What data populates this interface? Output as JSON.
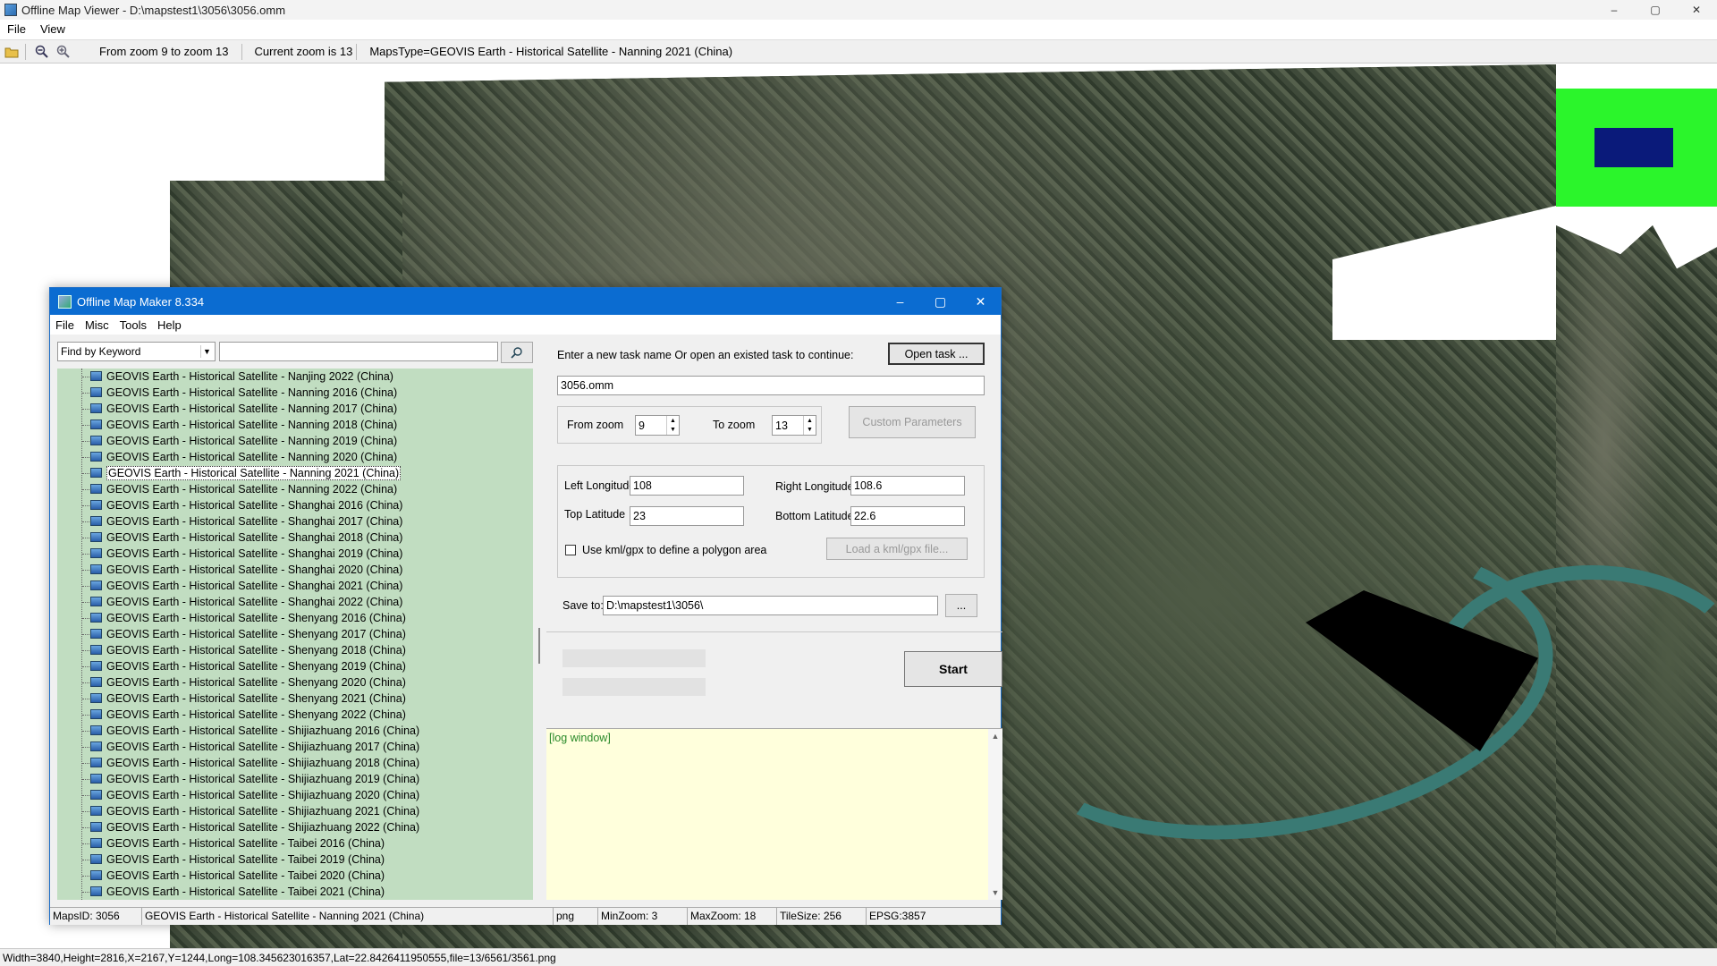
{
  "main": {
    "title": "Offline Map Viewer - D:\\mapstest1\\3056\\3056.omm",
    "menu": [
      "File",
      "View"
    ],
    "toolbar": {
      "zoom_range": "From zoom 9 to zoom 13",
      "current_zoom": "Current zoom is 13",
      "maps_type": "MapsType=GEOVIS Earth - Historical Satellite - Nanning 2021 (China)"
    },
    "status": "Width=3840,Height=2816,X=2167,Y=1244,Long=108.345623016357,Lat=22.8426411950555,file=13/6561/3561.png",
    "controls": {
      "minimize": "–",
      "maximize": "▢",
      "close": "✕"
    }
  },
  "dialog": {
    "title": "Offline Map Maker 8.334",
    "menu": [
      "File",
      "Misc",
      "Tools",
      "Help"
    ],
    "search": {
      "mode": "Find by Keyword",
      "keyword": ""
    },
    "tree_items": [
      "GEOVIS Earth - Historical Satellite - Nanjing 2022 (China)",
      "GEOVIS Earth - Historical Satellite - Nanning 2016 (China)",
      "GEOVIS Earth - Historical Satellite - Nanning 2017 (China)",
      "GEOVIS Earth - Historical Satellite - Nanning 2018 (China)",
      "GEOVIS Earth - Historical Satellite - Nanning 2019 (China)",
      "GEOVIS Earth - Historical Satellite - Nanning 2020 (China)",
      "GEOVIS Earth - Historical Satellite - Nanning 2021 (China)",
      "GEOVIS Earth - Historical Satellite - Nanning 2022 (China)",
      "GEOVIS Earth - Historical Satellite - Shanghai 2016 (China)",
      "GEOVIS Earth - Historical Satellite - Shanghai 2017 (China)",
      "GEOVIS Earth - Historical Satellite - Shanghai 2018 (China)",
      "GEOVIS Earth - Historical Satellite - Shanghai 2019 (China)",
      "GEOVIS Earth - Historical Satellite - Shanghai 2020 (China)",
      "GEOVIS Earth - Historical Satellite - Shanghai 2021 (China)",
      "GEOVIS Earth - Historical Satellite - Shanghai 2022 (China)",
      "GEOVIS Earth - Historical Satellite - Shenyang 2016 (China)",
      "GEOVIS Earth - Historical Satellite - Shenyang 2017 (China)",
      "GEOVIS Earth - Historical Satellite - Shenyang 2018 (China)",
      "GEOVIS Earth - Historical Satellite - Shenyang 2019 (China)",
      "GEOVIS Earth - Historical Satellite - Shenyang 2020 (China)",
      "GEOVIS Earth - Historical Satellite - Shenyang 2021 (China)",
      "GEOVIS Earth - Historical Satellite - Shenyang 2022 (China)",
      "GEOVIS Earth - Historical Satellite - Shijiazhuang 2016 (China)",
      "GEOVIS Earth - Historical Satellite - Shijiazhuang 2017 (China)",
      "GEOVIS Earth - Historical Satellite - Shijiazhuang 2018 (China)",
      "GEOVIS Earth - Historical Satellite - Shijiazhuang 2019 (China)",
      "GEOVIS Earth - Historical Satellite - Shijiazhuang 2020 (China)",
      "GEOVIS Earth - Historical Satellite - Shijiazhuang 2021 (China)",
      "GEOVIS Earth - Historical Satellite - Shijiazhuang 2022 (China)",
      "GEOVIS Earth - Historical Satellite - Taibei 2016 (China)",
      "GEOVIS Earth - Historical Satellite - Taibei 2019 (China)",
      "GEOVIS Earth - Historical Satellite - Taibei 2020 (China)",
      "GEOVIS Earth - Historical Satellite - Taibei 2021 (China)"
    ],
    "selected_index": 6,
    "task_prompt": "Enter a new task name Or open an existed task to continue:",
    "open_task_label": "Open task ...",
    "task_name": "3056.omm",
    "from_zoom_label": "From zoom",
    "from_zoom": "9",
    "to_zoom_label": "To zoom",
    "to_zoom": "13",
    "custom_params_label": "Custom Parameters",
    "left_lon_label": "Left Longitude",
    "left_lon": "108",
    "right_lon_label": "Right Longitude",
    "right_lon": "108.6",
    "top_lat_label": "Top Latitude",
    "top_lat": "23",
    "bottom_lat_label": "Bottom Latitude",
    "bottom_lat": "22.6",
    "kml_label": "Use kml/gpx to define a polygon area",
    "load_kml_label": "Load a kml/gpx file...",
    "save_to_label": "Save to:",
    "save_to": "D:\\mapstest1\\3056\\",
    "browse_label": "...",
    "start_label": "Start",
    "log_text": "[log window]",
    "status": {
      "maps_id": "MapsID: 3056",
      "maps_name": "GEOVIS Earth - Historical Satellite - Nanning 2021 (China)",
      "format": "png",
      "min_zoom": "MinZoom: 3",
      "max_zoom": "MaxZoom: 18",
      "tile_size": "TileSize: 256",
      "epsg": "EPSG:3857"
    }
  }
}
